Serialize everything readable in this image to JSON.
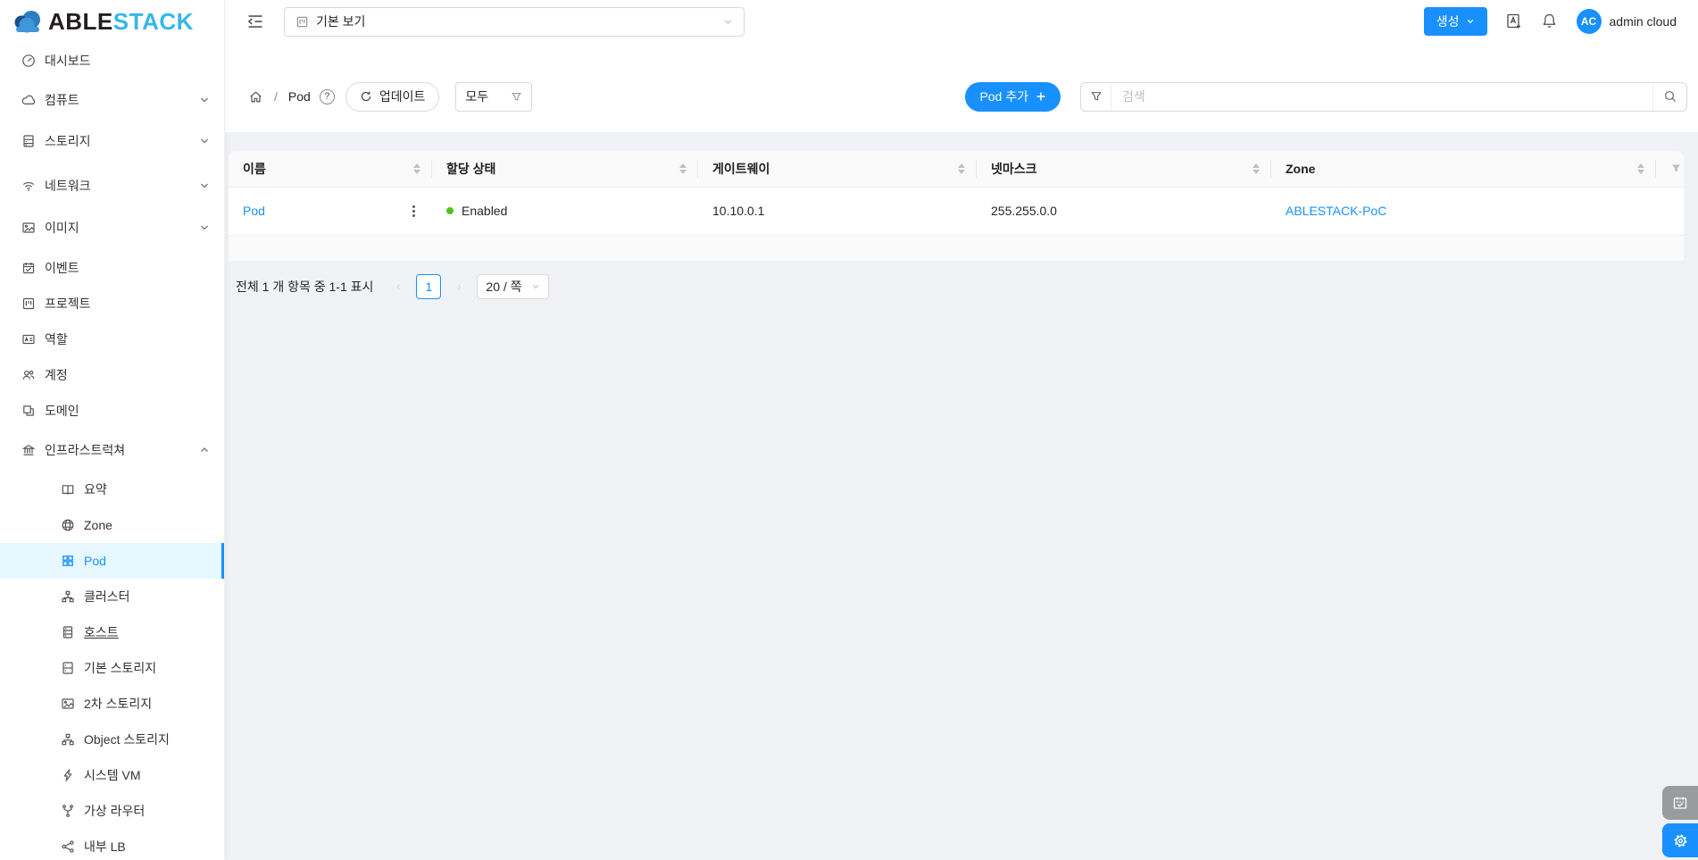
{
  "colors": {
    "accent": "#1890ff",
    "selected_menu_bg": "#e6f7ff",
    "status_enabled_green": "#52c41a",
    "logo_dark": "#231f20",
    "logo_cyan": "#36b7e9",
    "logo_cloud_dark": "#1b4e8f",
    "logo_cloud_light": "#2d7dc3",
    "body_bg": "#f0f2f5",
    "table_header_bg": "#fafafa"
  },
  "header": {
    "logo_able": "ABLE",
    "logo_stack": "STACK",
    "view_select_value": "기본 보기",
    "create_button": "생성",
    "user": {
      "initials": "AC",
      "name": "admin cloud"
    }
  },
  "sidebar": {
    "items": [
      {
        "label": "대시보드",
        "icon": "dashboard-icon"
      },
      {
        "label": "컴퓨트",
        "icon": "cloud-icon",
        "expandable": true
      },
      {
        "label": "스토리지",
        "icon": "hdd-icon",
        "expandable": true
      },
      {
        "label": "네트워크",
        "icon": "wifi-icon",
        "expandable": true
      },
      {
        "label": "이미지",
        "icon": "picture-icon",
        "expandable": true
      },
      {
        "label": "이벤트",
        "icon": "calendar-check-icon"
      },
      {
        "label": "프로젝트",
        "icon": "project-icon"
      },
      {
        "label": "역할",
        "icon": "idcard-icon"
      },
      {
        "label": "계정",
        "icon": "team-icon"
      },
      {
        "label": "도메인",
        "icon": "block-icon"
      },
      {
        "label": "인프라스트럭쳐",
        "icon": "bank-icon",
        "expandable": true,
        "expanded": true
      },
      {
        "label": "요약",
        "icon": "read-icon",
        "sub": true
      },
      {
        "label": "Zone",
        "icon": "global-icon",
        "sub": true
      },
      {
        "label": "Pod",
        "icon": "appstore-icon",
        "sub": true,
        "selected": true
      },
      {
        "label": "클러스터",
        "icon": "cluster-icon",
        "sub": true
      },
      {
        "label": "호스트",
        "icon": "server-icon",
        "sub": true
      },
      {
        "label": "기본 스토리지",
        "icon": "database-icon",
        "sub": true
      },
      {
        "label": "2차 스토리지",
        "icon": "picture-icon",
        "sub": true
      },
      {
        "label": "Object 스토리지",
        "icon": "apartment-icon",
        "sub": true
      },
      {
        "label": "시스템 VM",
        "icon": "thunderbolt-icon",
        "sub": true
      },
      {
        "label": "가상 라우터",
        "icon": "fork-icon",
        "sub": true
      },
      {
        "label": "내부 LB",
        "icon": "share-icon",
        "sub": true
      }
    ]
  },
  "toolbar": {
    "breadcrumb_current": "Pod",
    "breadcrumb_separator": "/",
    "help_glyph": "?",
    "refresh_button": "업데이트",
    "filter_select_value": "모두",
    "add_button": "Pod 추가",
    "search_placeholder": "검색"
  },
  "table": {
    "columns": [
      "이름",
      "할당 상태",
      "게이트웨이",
      "넷마스크",
      "Zone"
    ],
    "rows": [
      {
        "name": "Pod",
        "state": "Enabled",
        "gateway": "10.10.0.1",
        "netmask": "255.255.0.0",
        "zone": "ABLESTACK-PoC"
      }
    ]
  },
  "pagination": {
    "summary": "전체 1 개 항목 중 1-1 표시",
    "prev_glyph": "‹",
    "next_glyph": "›",
    "page": "1",
    "page_size": "20 / 쪽"
  }
}
